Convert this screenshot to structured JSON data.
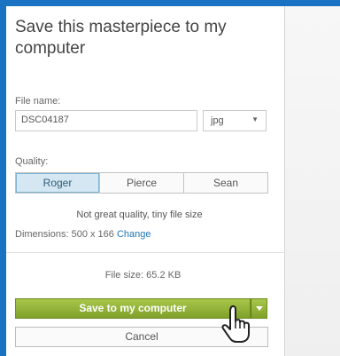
{
  "dialog": {
    "title": "Save this masterpiece to my computer",
    "file_name_label": "File name:",
    "file_name_value": "DSC04187",
    "extension_value": "jpg",
    "quality_label": "Quality:",
    "quality_options": [
      "Roger",
      "Pierce",
      "Sean"
    ],
    "quality_selected": "Roger",
    "quality_description": "Not great quality, tiny file size",
    "dimensions_label": "Dimensions:",
    "dimensions_value": "500 x 166",
    "change_link": "Change",
    "file_size": "File size: 65.2 KB",
    "save_button": "Save to my computer",
    "cancel_button": "Cancel"
  },
  "colors": {
    "frame": "#1a73c2",
    "save_green": "#8fb03a",
    "selected_segment": "#d4e7f2",
    "link": "#1f77b4"
  }
}
